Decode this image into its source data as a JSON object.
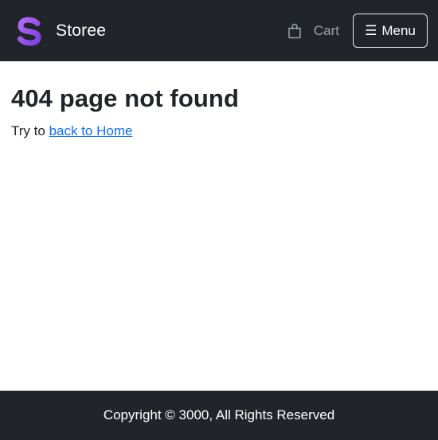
{
  "navbar": {
    "brand_name": "Storee",
    "brand_logo_icon": "storee-s-logo",
    "brand_logo_colors": [
      "#a855f7",
      "#7c3aed"
    ],
    "cart_icon": "shopping-bag-icon",
    "cart_label": "Cart",
    "menu_icon": "hamburger-icon",
    "menu_glyph": "☰",
    "menu_label": "Menu"
  },
  "main": {
    "heading": "404 page not found",
    "try_prefix": "Try to",
    "home_link_label": "back to Home"
  },
  "footer": {
    "copyright": "Copyright © 3000, All Rights Reserved"
  },
  "colors": {
    "navbar_bg": "#212529",
    "link": "#0d6efd",
    "muted": "#9ea3a8"
  }
}
